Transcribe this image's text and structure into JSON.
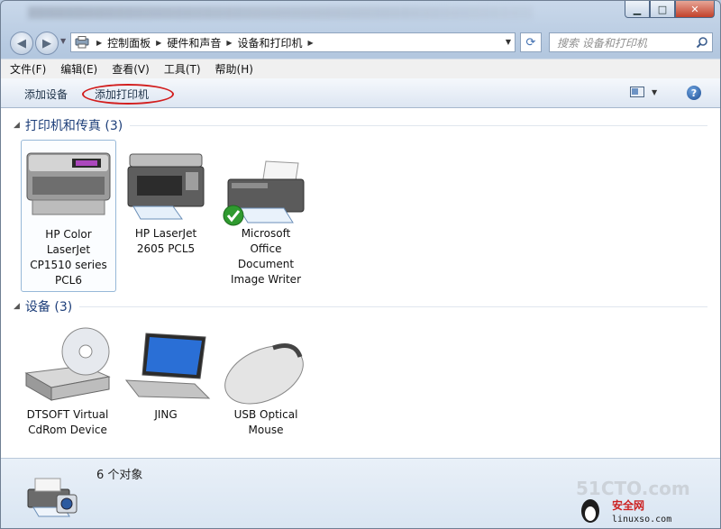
{
  "address": {
    "breadcrumbs": [
      "控制面板",
      "硬件和声音",
      "设备和打印机"
    ]
  },
  "search": {
    "placeholder": "搜索 设备和打印机"
  },
  "menubar": {
    "items": [
      "文件(F)",
      "编辑(E)",
      "查看(V)",
      "工具(T)",
      "帮助(H)"
    ]
  },
  "commandbar": {
    "add_device": "添加设备",
    "add_printer": "添加打印机"
  },
  "groups": {
    "printers": {
      "title": "打印机和传真 (3)",
      "items": [
        {
          "name": "HP Color LaserJet CP1510 series PCL6",
          "lines": [
            "HP Color",
            "LaserJet",
            "CP1510 series",
            "PCL6"
          ],
          "selected": true
        },
        {
          "name": "HP LaserJet 2605 PCL5",
          "lines": [
            "HP LaserJet",
            "2605 PCL5"
          ]
        },
        {
          "name": "Microsoft Office Document Image Writer",
          "lines": [
            "Microsoft",
            "Office",
            "Document",
            "Image Writer"
          ],
          "default": true
        }
      ]
    },
    "devices": {
      "title": "设备 (3)",
      "items": [
        {
          "name": "DTSOFT Virtual CdRom Device",
          "lines": [
            "DTSOFT Virtual",
            "CdRom Device"
          ]
        },
        {
          "name": "JING",
          "lines": [
            "JING"
          ]
        },
        {
          "name": "USB Optical Mouse",
          "lines": [
            "USB Optical",
            "Mouse"
          ]
        }
      ]
    }
  },
  "details": {
    "count": "6 个对象"
  },
  "watermark": {
    "logo_text": "51CTO.com 技术博客 Blog 安全网 linuxso.com"
  },
  "colors": {
    "group_title": "#1e3f7a",
    "highlight_oval": "#d21e1e",
    "selection_border": "#97b8d8"
  }
}
